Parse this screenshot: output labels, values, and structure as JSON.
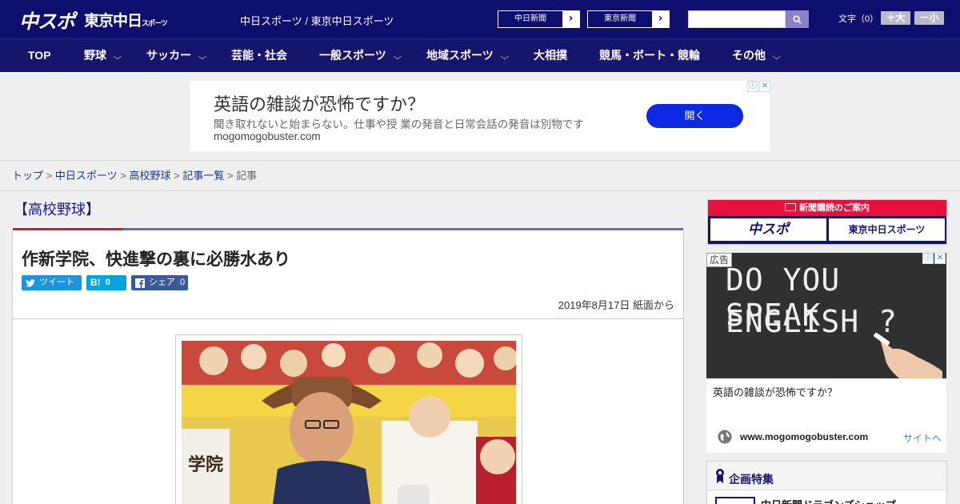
{
  "header": {
    "logo_main": "中スポ",
    "logo_tokyo": "東京中日",
    "logo_tokyo_sub": "スポーツ",
    "site_links": "中日スポーツ / 東京中日スポーツ",
    "newspaper_buttons": [
      {
        "label": "中日新聞",
        "arrow": "›"
      },
      {
        "label": "東京新聞",
        "arrow": "›"
      }
    ],
    "search": {
      "value": "",
      "icon": "search-icon"
    },
    "font_size_label": "文字（0）",
    "font_larger": "＋大",
    "font_smaller": "－小"
  },
  "nav": {
    "items": [
      {
        "label": "TOP",
        "has_dropdown": false
      },
      {
        "label": "野球",
        "has_dropdown": true
      },
      {
        "label": "サッカー",
        "has_dropdown": true
      },
      {
        "label": "芸能・社会",
        "has_dropdown": false
      },
      {
        "label": "一般スポーツ",
        "has_dropdown": true
      },
      {
        "label": "地域スポーツ",
        "has_dropdown": true
      },
      {
        "label": "大相撲",
        "has_dropdown": false
      },
      {
        "label": "競馬・ボート・競輪",
        "has_dropdown": false
      },
      {
        "label": "その他",
        "has_dropdown": true
      }
    ],
    "chevron": "⌵"
  },
  "top_ad": {
    "title": "英語の雑談が恐怖ですか？",
    "description": "聞き取れないと始まらない。仕事や授 業の発音と日常会話の発音は別物です",
    "url": "mogomogobuster.com",
    "button": "開く",
    "adchoices_info": "ⓘ",
    "adchoices_close": "✕"
  },
  "breadcrumb": {
    "items": [
      "トップ",
      "中日スポーツ",
      "高校野球",
      "記事一覧"
    ],
    "current": "記事",
    "separator": ">"
  },
  "article": {
    "section": "【高校野球】",
    "headline": "作新学院、快進撃の裏に必勝水あり",
    "share": {
      "tweet": "ツイート",
      "hatena_count": "0",
      "facebook_label": "シェア",
      "facebook_count": "0"
    },
    "dateline": "2019年8月17日 紙面から"
  },
  "sidebar": {
    "subscribe": {
      "heading": "新聞購読のご案内",
      "buttons": [
        "中スポ",
        "東京中日スポーツ"
      ]
    },
    "ad": {
      "label": "広告",
      "chalk_line1": "DO YOU SPEAK",
      "chalk_line2": "ENGLISH ?",
      "text": "英語の雑談が恐怖ですか？",
      "url": "www.mogomogobuster.com",
      "site_link": "サイトへ"
    },
    "feature": {
      "title": "企画特集",
      "first_item": "中日新聞ドラゴンズショップ"
    }
  },
  "colors": {
    "header_bg": "#0e0e6e",
    "nav_bg": "#16156c",
    "accent_red": "#e8113d",
    "ad_button": "#0a29e0",
    "twitter": "#1b95e0",
    "hatena": "#00a4de",
    "facebook": "#3b5998"
  }
}
